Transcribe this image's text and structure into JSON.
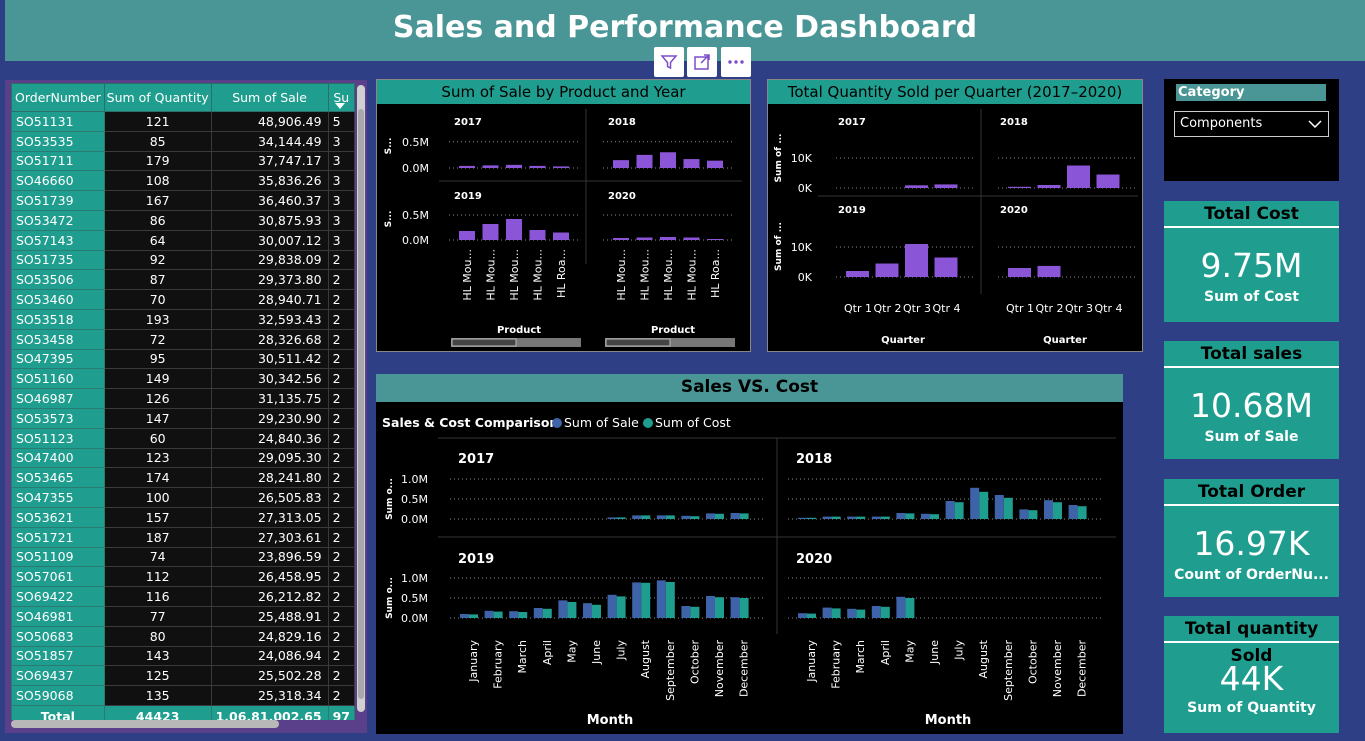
{
  "header": {
    "title": "Sales and Performance Dashboard"
  },
  "toolbar": {
    "filter_icon": "filter-icon",
    "focus_icon": "focus-mode-icon",
    "more_icon": "more-options-icon"
  },
  "colors": {
    "teal": "#1f9e8f",
    "header": "#4a9595",
    "purple": "#8a55d6",
    "blue": "#3f63a8",
    "background": "#2f3f86"
  },
  "table": {
    "headers": [
      "OrderNumber",
      "Sum of Quantity",
      "Sum of Sale",
      "Su"
    ],
    "rows": [
      [
        "SO51131",
        "121",
        "48,906.49",
        "5"
      ],
      [
        "SO53535",
        "85",
        "34,144.49",
        "3"
      ],
      [
        "SO51711",
        "179",
        "37,747.17",
        "3"
      ],
      [
        "SO46660",
        "108",
        "35,836.26",
        "3"
      ],
      [
        "SO51739",
        "167",
        "36,460.37",
        "3"
      ],
      [
        "SO53472",
        "86",
        "30,875.93",
        "3"
      ],
      [
        "SO57143",
        "64",
        "30,007.12",
        "3"
      ],
      [
        "SO51735",
        "92",
        "29,838.09",
        "2"
      ],
      [
        "SO53506",
        "87",
        "29,373.80",
        "2"
      ],
      [
        "SO53460",
        "70",
        "28,940.71",
        "2"
      ],
      [
        "SO53518",
        "193",
        "32,593.43",
        "2"
      ],
      [
        "SO53458",
        "72",
        "28,326.68",
        "2"
      ],
      [
        "SO47395",
        "95",
        "30,511.42",
        "2"
      ],
      [
        "SO51160",
        "149",
        "30,342.56",
        "2"
      ],
      [
        "SO46987",
        "126",
        "31,135.75",
        "2"
      ],
      [
        "SO53573",
        "147",
        "29,230.90",
        "2"
      ],
      [
        "SO51123",
        "60",
        "24,840.36",
        "2"
      ],
      [
        "SO47400",
        "123",
        "29,095.30",
        "2"
      ],
      [
        "SO53465",
        "174",
        "28,241.80",
        "2"
      ],
      [
        "SO47355",
        "100",
        "26,505.83",
        "2"
      ],
      [
        "SO53621",
        "157",
        "27,313.05",
        "2"
      ],
      [
        "SO51721",
        "187",
        "27,303.61",
        "2"
      ],
      [
        "SO51109",
        "74",
        "23,896.59",
        "2"
      ],
      [
        "SO57061",
        "112",
        "26,458.95",
        "2"
      ],
      [
        "SO69422",
        "116",
        "26,212.82",
        "2"
      ],
      [
        "SO46981",
        "77",
        "25,488.91",
        "2"
      ],
      [
        "SO50683",
        "80",
        "24,829.16",
        "2"
      ],
      [
        "SO51857",
        "143",
        "24,086.94",
        "2"
      ],
      [
        "SO69437",
        "125",
        "25,502.28",
        "2"
      ],
      [
        "SO59068",
        "135",
        "25,318.34",
        "2"
      ]
    ],
    "total": [
      "Total",
      "44423",
      "1,06,81,002.65",
      "97"
    ]
  },
  "slicer": {
    "label": "Category",
    "selected": "Components",
    "chevron_icon": "chevron-down-icon"
  },
  "kpis": [
    {
      "title": "Total Cost",
      "value": "9.75M",
      "subtitle": "Sum of Cost"
    },
    {
      "title": "Total sales",
      "value": "10.68M",
      "subtitle": "Sum of Sale"
    },
    {
      "title": "Total Order",
      "value": "16.97K",
      "subtitle": "Count of OrderNu..."
    },
    {
      "title": "Total quantity Sold",
      "value": "44K",
      "subtitle": "Sum of Quantity"
    }
  ],
  "chart_data": [
    {
      "type": "bar",
      "title": "Sum of Sale by Product and Year",
      "xlabel": "Product",
      "ylabel": "S...",
      "yticks": [
        "0.0M",
        "0.5M"
      ],
      "ylim": [
        0,
        0.8
      ],
      "categories": [
        "HL Mou...",
        "HL Mou...",
        "HL Mou...",
        "HL Mou...",
        "HL Roa..."
      ],
      "panels": [
        {
          "label": "2017",
          "values": [
            0.04,
            0.05,
            0.06,
            0.04,
            0.03
          ]
        },
        {
          "label": "2018",
          "values": [
            0.15,
            0.25,
            0.3,
            0.17,
            0.14
          ]
        },
        {
          "label": "2019",
          "values": [
            0.18,
            0.32,
            0.42,
            0.2,
            0.15
          ]
        },
        {
          "label": "2020",
          "values": [
            0.04,
            0.05,
            0.06,
            0.05,
            0.02
          ]
        }
      ]
    },
    {
      "type": "bar",
      "title": "Total Quantity Sold per Quarter (2017–2020)",
      "xlabel": "Quarter",
      "ylabel": "Sum of ...",
      "yticks": [
        "0K",
        "10K"
      ],
      "ylim": [
        0,
        16000
      ],
      "categories": [
        "Qtr 1",
        "Qtr 2",
        "Qtr 3",
        "Qtr 4"
      ],
      "panels": [
        {
          "label": "2017",
          "values": [
            null,
            null,
            900,
            1200
          ]
        },
        {
          "label": "2018",
          "values": [
            400,
            1000,
            7500,
            4500
          ]
        },
        {
          "label": "2019",
          "values": [
            2000,
            4500,
            11000,
            6500
          ]
        },
        {
          "label": "2020",
          "values": [
            3000,
            3700,
            null,
            null
          ]
        }
      ]
    },
    {
      "type": "bar",
      "title": "Sales VS. Cost",
      "subtitle": "Sales & Cost Comparison",
      "xlabel": "Month",
      "ylabel": "Sum o...",
      "yticks": [
        "0.0M",
        "0.5M",
        "1.0M"
      ],
      "ylim": [
        0,
        1.15
      ],
      "categories": [
        "January",
        "February",
        "March",
        "April",
        "May",
        "June",
        "July",
        "August",
        "September",
        "October",
        "November",
        "December"
      ],
      "series_names": [
        "Sum of Sale",
        "Sum of Cost"
      ],
      "panels": [
        {
          "label": "2017",
          "sale": [
            null,
            null,
            null,
            null,
            null,
            null,
            0.04,
            0.09,
            0.09,
            0.08,
            0.14,
            0.15
          ],
          "cost": [
            null,
            null,
            null,
            null,
            null,
            null,
            0.04,
            0.09,
            0.09,
            0.07,
            0.13,
            0.14
          ]
        },
        {
          "label": "2018",
          "sale": [
            0.03,
            0.06,
            0.06,
            0.06,
            0.15,
            0.13,
            0.45,
            0.78,
            0.6,
            0.24,
            0.47,
            0.35
          ],
          "cost": [
            0.03,
            0.06,
            0.06,
            0.06,
            0.14,
            0.12,
            0.42,
            0.68,
            0.53,
            0.22,
            0.42,
            0.32
          ]
        },
        {
          "label": "2019",
          "sale": [
            0.1,
            0.18,
            0.17,
            0.25,
            0.44,
            0.37,
            0.58,
            0.89,
            0.94,
            0.3,
            0.55,
            0.52
          ],
          "cost": [
            0.09,
            0.16,
            0.15,
            0.23,
            0.4,
            0.33,
            0.54,
            0.88,
            0.9,
            0.28,
            0.52,
            0.5
          ]
        },
        {
          "label": "2020",
          "sale": [
            0.12,
            0.26,
            0.23,
            0.3,
            0.53,
            null,
            null,
            null,
            null,
            null,
            null,
            null
          ],
          "cost": [
            0.11,
            0.24,
            0.21,
            0.28,
            0.5,
            null,
            null,
            null,
            null,
            null,
            null,
            null
          ]
        }
      ]
    }
  ]
}
